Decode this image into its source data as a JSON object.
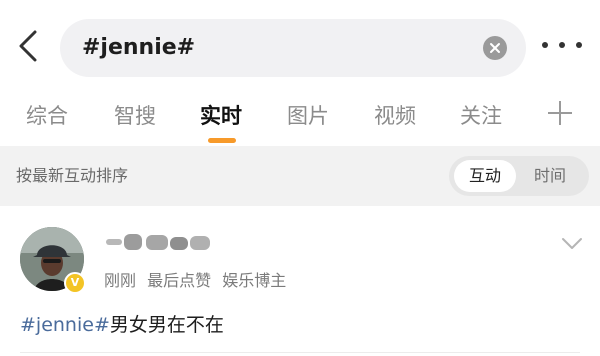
{
  "search": {
    "query": "#jennie#"
  },
  "tabs": [
    {
      "label": "综合",
      "active": false
    },
    {
      "label": "智搜",
      "active": false
    },
    {
      "label": "实时",
      "active": true
    },
    {
      "label": "图片",
      "active": false
    },
    {
      "label": "视频",
      "active": false
    },
    {
      "label": "关注",
      "active": false
    }
  ],
  "sort": {
    "label": "按最新互动排序",
    "options": [
      {
        "label": "互动",
        "selected": true
      },
      {
        "label": "时间",
        "selected": false
      }
    ]
  },
  "post": {
    "meta": [
      "刚刚",
      "最后点赞",
      "娱乐博主"
    ],
    "hashtag": "#jennie#",
    "text": "男女男在不在"
  },
  "colors": {
    "accent": "#f79a2a",
    "hashtag": "#4a6b9b",
    "verified_badge": "#f3c425"
  },
  "icons": [
    "back-arrow-icon",
    "clear-icon",
    "more-icon",
    "add-tab-icon",
    "verified-badge-icon",
    "chevron-down-icon"
  ]
}
